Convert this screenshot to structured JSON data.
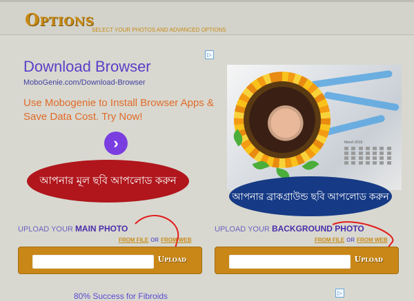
{
  "header": {
    "title": "Options",
    "subtitle": "SELECT YOUR PHOTOS AND ADVANCED OPTIONS"
  },
  "ad": {
    "title": "Download Browser",
    "url": "MoboGenie.com/Download-Browser",
    "body": "Use Mobogenie to Install Browser Apps & Save Data Cost. Try Now!",
    "arrow_icon": "›",
    "adchoices_icon": "▷"
  },
  "preview": {
    "calendar_title": "March 2015"
  },
  "banners": {
    "main": "আপনার মূল ছবি আপলোড করুন",
    "background": "আপনার ব্রাকগ্রাউন্ড ছবি আপলোড করুন"
  },
  "main_photo": {
    "label_prefix": "UPLOAD YOUR ",
    "label_strong": "MAIN PHOTO",
    "from_file": "FROM FILE",
    "or": "OR",
    "from_web": "FROM WEB",
    "input_value": "",
    "button": "Upload"
  },
  "background_photo": {
    "label_prefix": "UPLOAD YOUR ",
    "label_strong": "BACKGROUND PHOTO",
    "from_file": "FROM FILE",
    "or": "OR",
    "from_web": "FROM WEB",
    "input_value": "",
    "button": "Upload"
  },
  "bottom_ad": {
    "text": "80% Success for Fibroids"
  },
  "colors": {
    "accent": "#c88a14",
    "link": "#6a62c0",
    "banner_red": "#b0161c",
    "banner_blue": "#163a86"
  }
}
